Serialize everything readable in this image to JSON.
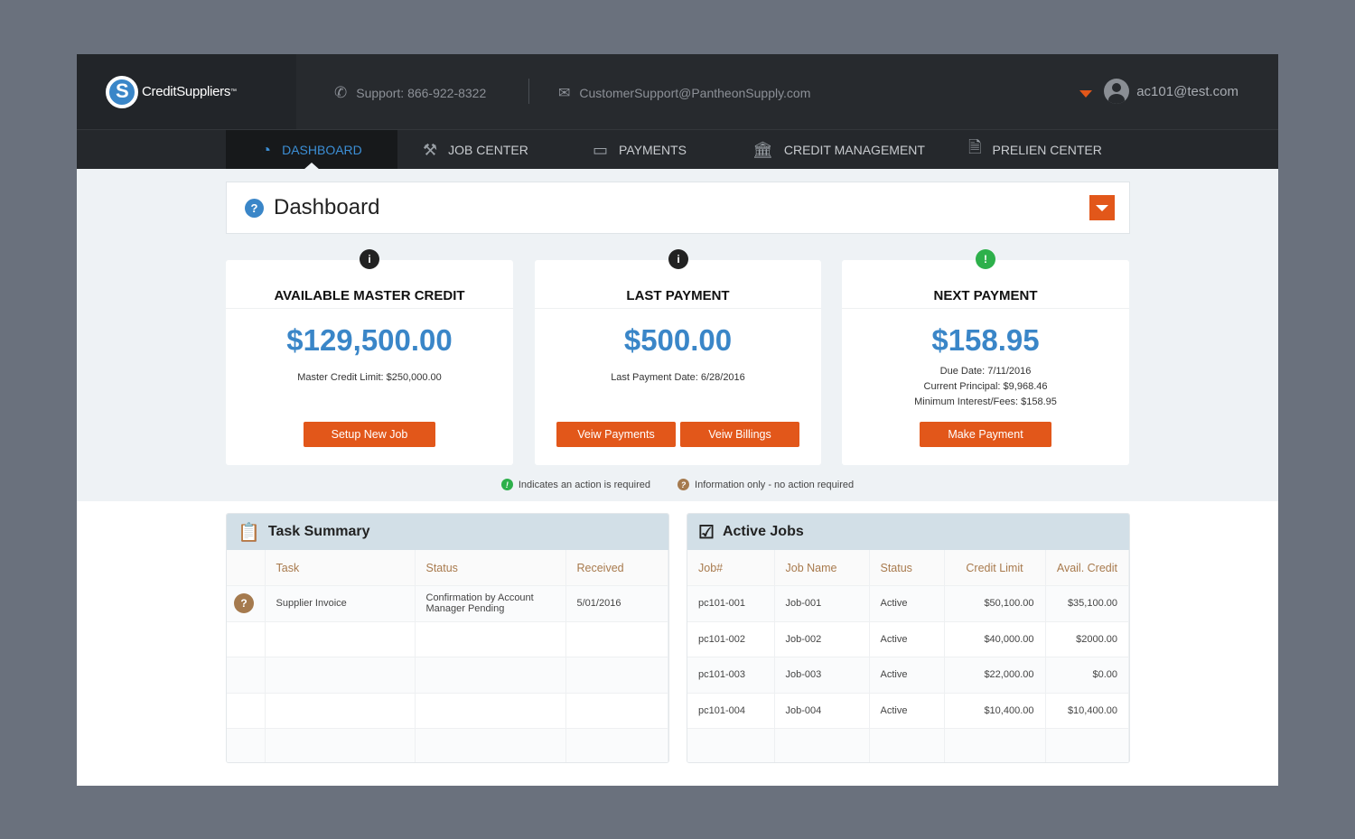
{
  "header": {
    "brand": "CreditSuppliers",
    "tm": "™",
    "support": "Support: 866-922-8322",
    "email": "CustomerSupport@PantheonSupply.com",
    "user": "ac101@test.com"
  },
  "nav": [
    {
      "label": "DASHBOARD",
      "icon": "speedometer-icon"
    },
    {
      "label": "JOB CENTER",
      "icon": "tools-icon"
    },
    {
      "label": "PAYMENTS",
      "icon": "credit-card-icon"
    },
    {
      "label": "CREDIT MANAGEMENT",
      "icon": "bank-icon"
    },
    {
      "label": "PRELIEN CENTER",
      "icon": "document-icon"
    }
  ],
  "page": {
    "title": "Dashboard",
    "help": "?"
  },
  "cards": [
    {
      "badge": "i",
      "title": "AVAILABLE MASTER CREDIT",
      "amount": "$129,500.00",
      "lines": [
        "Master Credit Limit: $250,000.00"
      ],
      "buttons": [
        "Setup New Job"
      ]
    },
    {
      "badge": "i",
      "title": "LAST PAYMENT",
      "amount": "$500.00",
      "lines": [
        "Last Payment Date: 6/28/2016"
      ],
      "buttons": [
        "Veiw Payments",
        "Veiw Billings"
      ]
    },
    {
      "badge": "!",
      "title": "NEXT PAYMENT",
      "amount": "$158.95",
      "lines": [
        "Due Date: 7/11/2016",
        "Current Principal: $9,968.46",
        "Minimum Interest/Fees: $158.95"
      ],
      "buttons": [
        "Make Payment"
      ]
    }
  ],
  "legend": {
    "action": "Indicates an action is required",
    "action_mark": "!",
    "info": "Information only - no action required",
    "info_mark": "?"
  },
  "tasks": {
    "title": "Task Summary",
    "headers": [
      "Task",
      "Status",
      "Received"
    ],
    "rows": [
      {
        "mark": "?",
        "task": "Supplier Invoice",
        "status": "Confirmation by Account Manager Pending",
        "received": "5/01/2016"
      }
    ]
  },
  "jobs": {
    "title": "Active Jobs",
    "headers": [
      "Job#",
      "Job Name",
      "Status",
      "Credit Limit",
      "Avail. Credit"
    ],
    "rows": [
      [
        "pc101-001",
        "Job-001",
        "Active",
        "$50,100.00",
        "$35,100.00"
      ],
      [
        "pc101-002",
        "Job-002",
        "Active",
        "$40,000.00",
        "$2000.00"
      ],
      [
        "pc101-003",
        "Job-003",
        "Active",
        "$22,000.00",
        "$0.00"
      ],
      [
        "pc101-004",
        "Job-004",
        "Active",
        "$10,400.00",
        "$10,400.00"
      ]
    ]
  },
  "colors": {
    "accent": "#e2571a",
    "blue": "#3a86c8",
    "green": "#2db04b",
    "info": "#a57a4e"
  }
}
